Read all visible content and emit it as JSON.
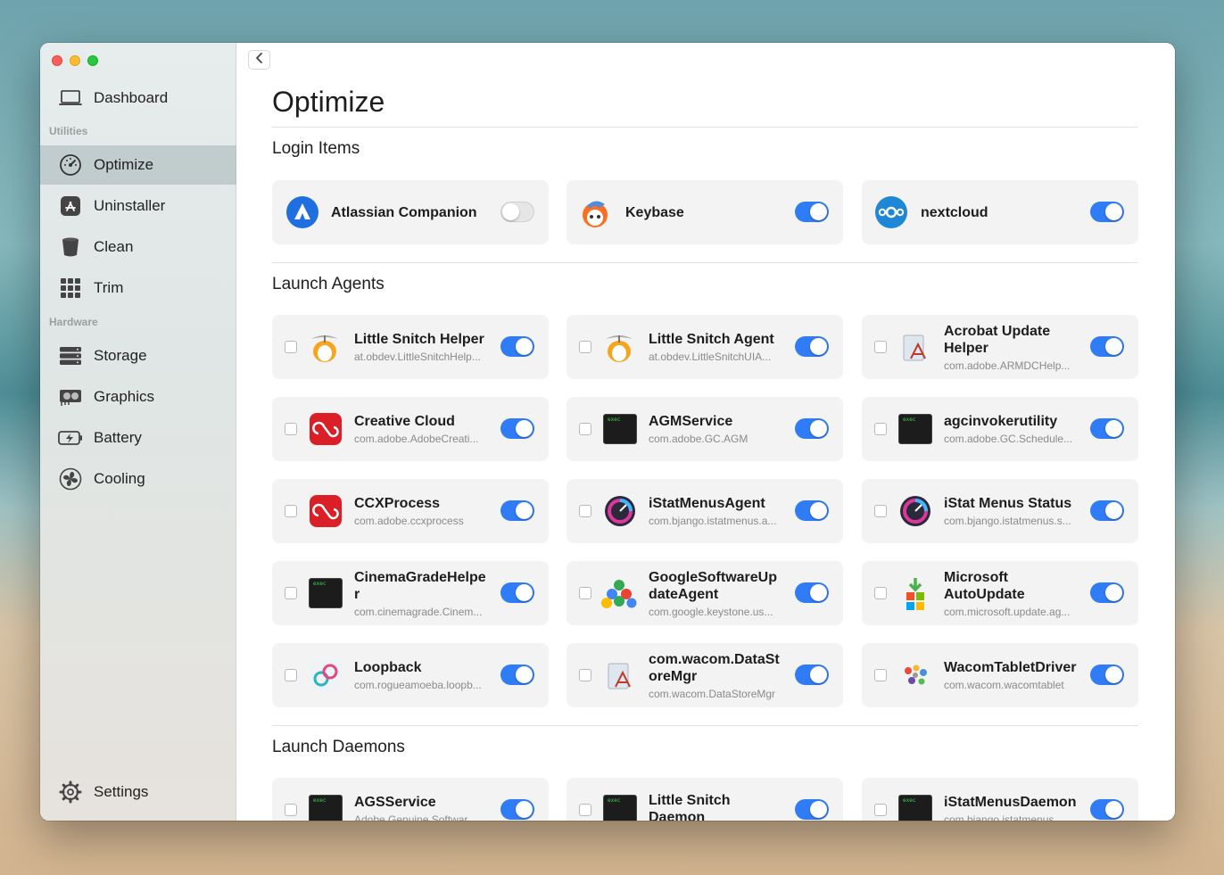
{
  "sidebar": {
    "dashboard": "Dashboard",
    "section_utilities": "Utilities",
    "optimize": "Optimize",
    "uninstaller": "Uninstaller",
    "clean": "Clean",
    "trim": "Trim",
    "section_hardware": "Hardware",
    "storage": "Storage",
    "graphics": "Graphics",
    "battery": "Battery",
    "cooling": "Cooling",
    "settings": "Settings"
  },
  "main": {
    "title": "Optimize",
    "login_items_title": "Login Items",
    "launch_agents_title": "Launch Agents",
    "launch_daemons_title": "Launch Daemons",
    "login_items": [
      {
        "name": "Atlassian Companion",
        "enabled": false
      },
      {
        "name": "Keybase",
        "enabled": true
      },
      {
        "name": "nextcloud",
        "enabled": true
      }
    ],
    "launch_agents": [
      {
        "name": "Little Snitch Helper",
        "id": "at.obdev.LittleSnitchHelp...",
        "enabled": true
      },
      {
        "name": "Little Snitch Agent",
        "id": "at.obdev.LittleSnitchUIA...",
        "enabled": true
      },
      {
        "name": "Acrobat Update Helper",
        "id": "com.adobe.ARMDCHelp...",
        "enabled": true
      },
      {
        "name": "Creative Cloud",
        "id": "com.adobe.AdobeCreati...",
        "enabled": true
      },
      {
        "name": "AGMService",
        "id": "com.adobe.GC.AGM",
        "enabled": true
      },
      {
        "name": "agcinvokerutility",
        "id": "com.adobe.GC.Schedule...",
        "enabled": true
      },
      {
        "name": "CCXProcess",
        "id": "com.adobe.ccxprocess",
        "enabled": true
      },
      {
        "name": "iStatMenusAgent",
        "id": "com.bjango.istatmenus.a...",
        "enabled": true
      },
      {
        "name": "iStat Menus Status",
        "id": "com.bjango.istatmenus.s...",
        "enabled": true
      },
      {
        "name": "CinemaGradeHelper",
        "id": "com.cinemagrade.Cinem...",
        "enabled": true
      },
      {
        "name": "GoogleSoftwareUpdateAgent",
        "id": "com.google.keystone.us...",
        "enabled": true
      },
      {
        "name": "Microsoft AutoUpdate",
        "id": "com.microsoft.update.ag...",
        "enabled": true
      },
      {
        "name": "Loopback",
        "id": "com.rogueamoeba.loopb...",
        "enabled": true
      },
      {
        "name": "com.wacom.DataStoreMgr",
        "id": "com.wacom.DataStoreMgr",
        "enabled": true
      },
      {
        "name": "WacomTabletDriver",
        "id": "com.wacom.wacomtablet",
        "enabled": true
      }
    ],
    "launch_daemons": [
      {
        "name": "AGSService",
        "id": "Adobe Genuine Softwar...",
        "enabled": true
      },
      {
        "name": "Little Snitch Daemon",
        "id": "",
        "enabled": true
      },
      {
        "name": "iStatMenusDaemon",
        "id": "com.bjango.istatmenus...",
        "enabled": true
      }
    ]
  },
  "icons": {
    "dashboard": "laptop-icon",
    "optimize": "speedometer-icon",
    "uninstaller": "app-store-icon",
    "clean": "trash-bin-icon",
    "trim": "grid-icon",
    "storage": "drive-stack-icon",
    "graphics": "gpu-icon",
    "battery": "battery-icon",
    "cooling": "fan-icon",
    "settings": "gear-icon"
  },
  "colors": {
    "toggle_on": "#2f7cf6",
    "sidebar_active": "#b6c2c4"
  }
}
